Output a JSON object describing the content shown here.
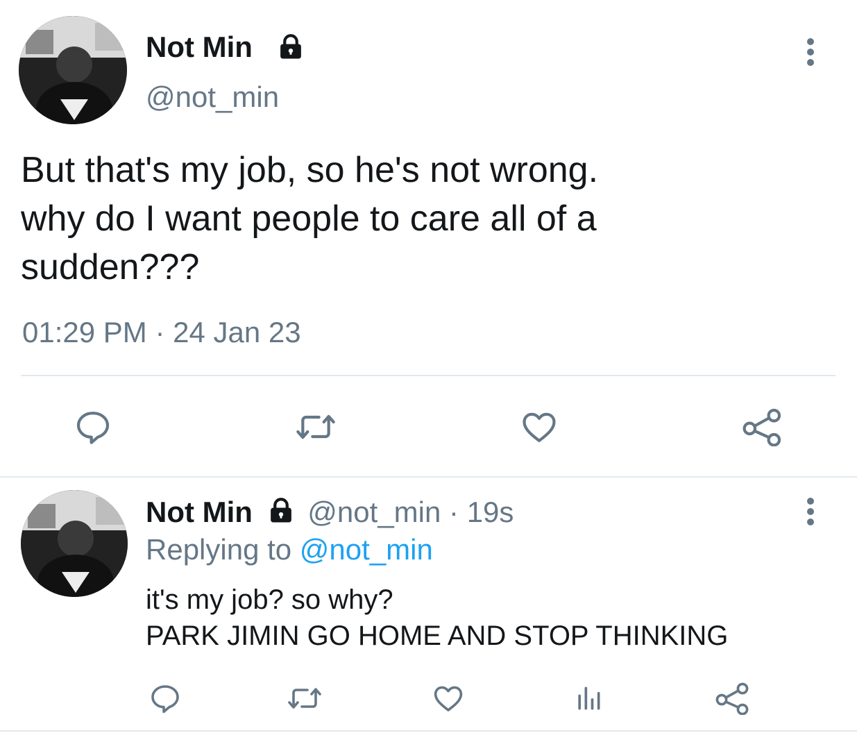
{
  "main_tweet": {
    "display_name": "Not Min",
    "handle": "@not_min",
    "body_lines": [
      "But that's my job, so he's not wrong.",
      "why do I want people to care all of a",
      "sudden???"
    ],
    "time": "01:29 PM",
    "separator": "·",
    "date": "24 Jan 23",
    "icons": [
      "lock-icon",
      "more-vertical-icon",
      "reply-icon",
      "retweet-icon",
      "like-icon",
      "share-icon"
    ]
  },
  "reply_tweet": {
    "display_name": "Not Min",
    "handle": "@not_min",
    "separator": "·",
    "age": "19s",
    "replying_prefix": "Replying to",
    "replying_handle": "@not_min",
    "body_lines": [
      "it's my job? so why?",
      "PARK JIMIN GO HOME AND STOP THINKING"
    ],
    "icons": [
      "lock-icon",
      "more-vertical-icon",
      "reply-icon",
      "retweet-icon",
      "like-icon",
      "analytics-icon",
      "share-icon"
    ]
  },
  "colors": {
    "text": "#14171a",
    "muted": "#657786",
    "link": "#1da1f2",
    "divider": "#e1e8ed"
  }
}
